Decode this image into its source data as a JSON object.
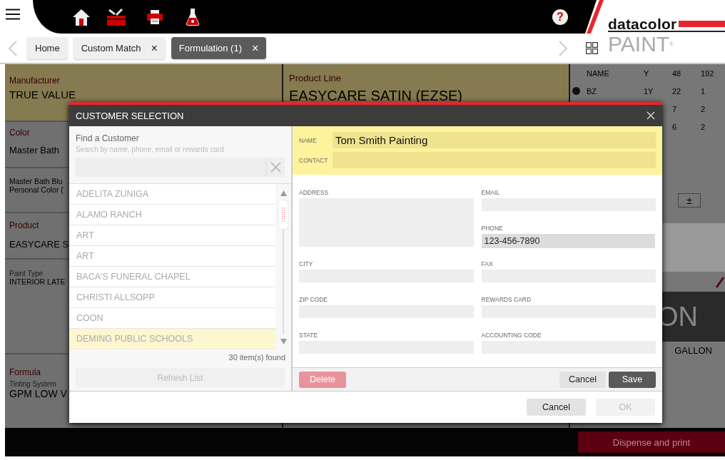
{
  "toolbar": {
    "help": "?"
  },
  "logo": {
    "brand": "datacolor",
    "product": "PAINT",
    "mark": "®"
  },
  "tabs": [
    {
      "label": "Home",
      "selected": false
    },
    {
      "label": "Custom Match",
      "close": "×",
      "selected": false
    },
    {
      "label": "Formulation (1)",
      "close": "×",
      "selected": true
    }
  ],
  "formulation": {
    "manufacturer": {
      "label": "Manufacturer",
      "value": "TRUE VALUE"
    },
    "color": {
      "label": "Color",
      "value": "Master Bath",
      "name": "Master Bath Blu",
      "type": "Personal Color ("
    },
    "product": {
      "label": "Product",
      "value": "EASYCARE S",
      "paint_type_label": "Paint Type",
      "paint_type": "INTERIOR LATE"
    },
    "formula": {
      "label": "Formula",
      "system_label": "Tinting System",
      "system": "GPM LOW V"
    },
    "product_line": {
      "label": "Product Line",
      "value": "EASYCARE SATIN (EZSE)"
    }
  },
  "colorant_table": {
    "columns": [
      "NAME",
      "Y",
      "48",
      "192"
    ],
    "rows": [
      {
        "cells": [
          "BZ",
          "1Y",
          "22",
          "1"
        ]
      },
      {
        "cells": [
          "",
          "",
          "7",
          "2"
        ]
      },
      {
        "cells": [
          "",
          "",
          "6",
          "2"
        ]
      }
    ]
  },
  "adjust_button": "±",
  "size": {
    "value": "ON",
    "unit": "GALLON"
  },
  "dispense_button": "Dispense and print",
  "dialog": {
    "title": "CUSTOMER SELECTION",
    "search": {
      "label": "Find a Customer",
      "hint": "Search by name, phone, email or rewards card"
    },
    "customers": [
      {
        "name": "ADELITA ZUNIGA",
        "selected": false
      },
      {
        "name": "ALAMO RANCH",
        "selected": false
      },
      {
        "name": "ART",
        "selected": false
      },
      {
        "name": "ART",
        "selected": false
      },
      {
        "name": "BACA'S FUNERAL CHAPEL",
        "selected": false
      },
      {
        "name": "CHRISTI ALLSOPP",
        "selected": false
      },
      {
        "name": "COON",
        "selected": false
      },
      {
        "name": "DEMING PUBLIC SCHOOLS",
        "selected": true
      }
    ],
    "count": "30 item(s) found",
    "refresh": {
      "label": "Refresh List",
      "disabled": true
    },
    "name": {
      "label": "NAME",
      "value": "Tom Smith Painting"
    },
    "contact": {
      "label": "CONTACT"
    },
    "left_fields": [
      {
        "label": "ADDRESS",
        "kind": "multiline",
        "focused": false
      },
      {
        "label": "CITY",
        "kind": "line",
        "focused": false
      },
      {
        "label": "ZIP CODE",
        "kind": "line",
        "focused": false
      },
      {
        "label": "STATE",
        "kind": "line",
        "focused": false
      }
    ],
    "right_fields": [
      {
        "label": "EMAIL",
        "kind": "line",
        "focused": false
      },
      {
        "label": "PHONE",
        "kind": "line",
        "value": "123-456-7890",
        "focused": true
      },
      {
        "label": "FAX",
        "kind": "line",
        "focused": false
      },
      {
        "label": "REWARDS CARD",
        "kind": "line",
        "focused": false
      },
      {
        "label": "ACCOUNTING CODE",
        "kind": "line",
        "focused": false
      }
    ],
    "delete": "Delete",
    "cancel": "Cancel",
    "save": "Save",
    "footer_cancel": "Cancel",
    "ok": {
      "label": "OK",
      "disabled": true
    }
  }
}
